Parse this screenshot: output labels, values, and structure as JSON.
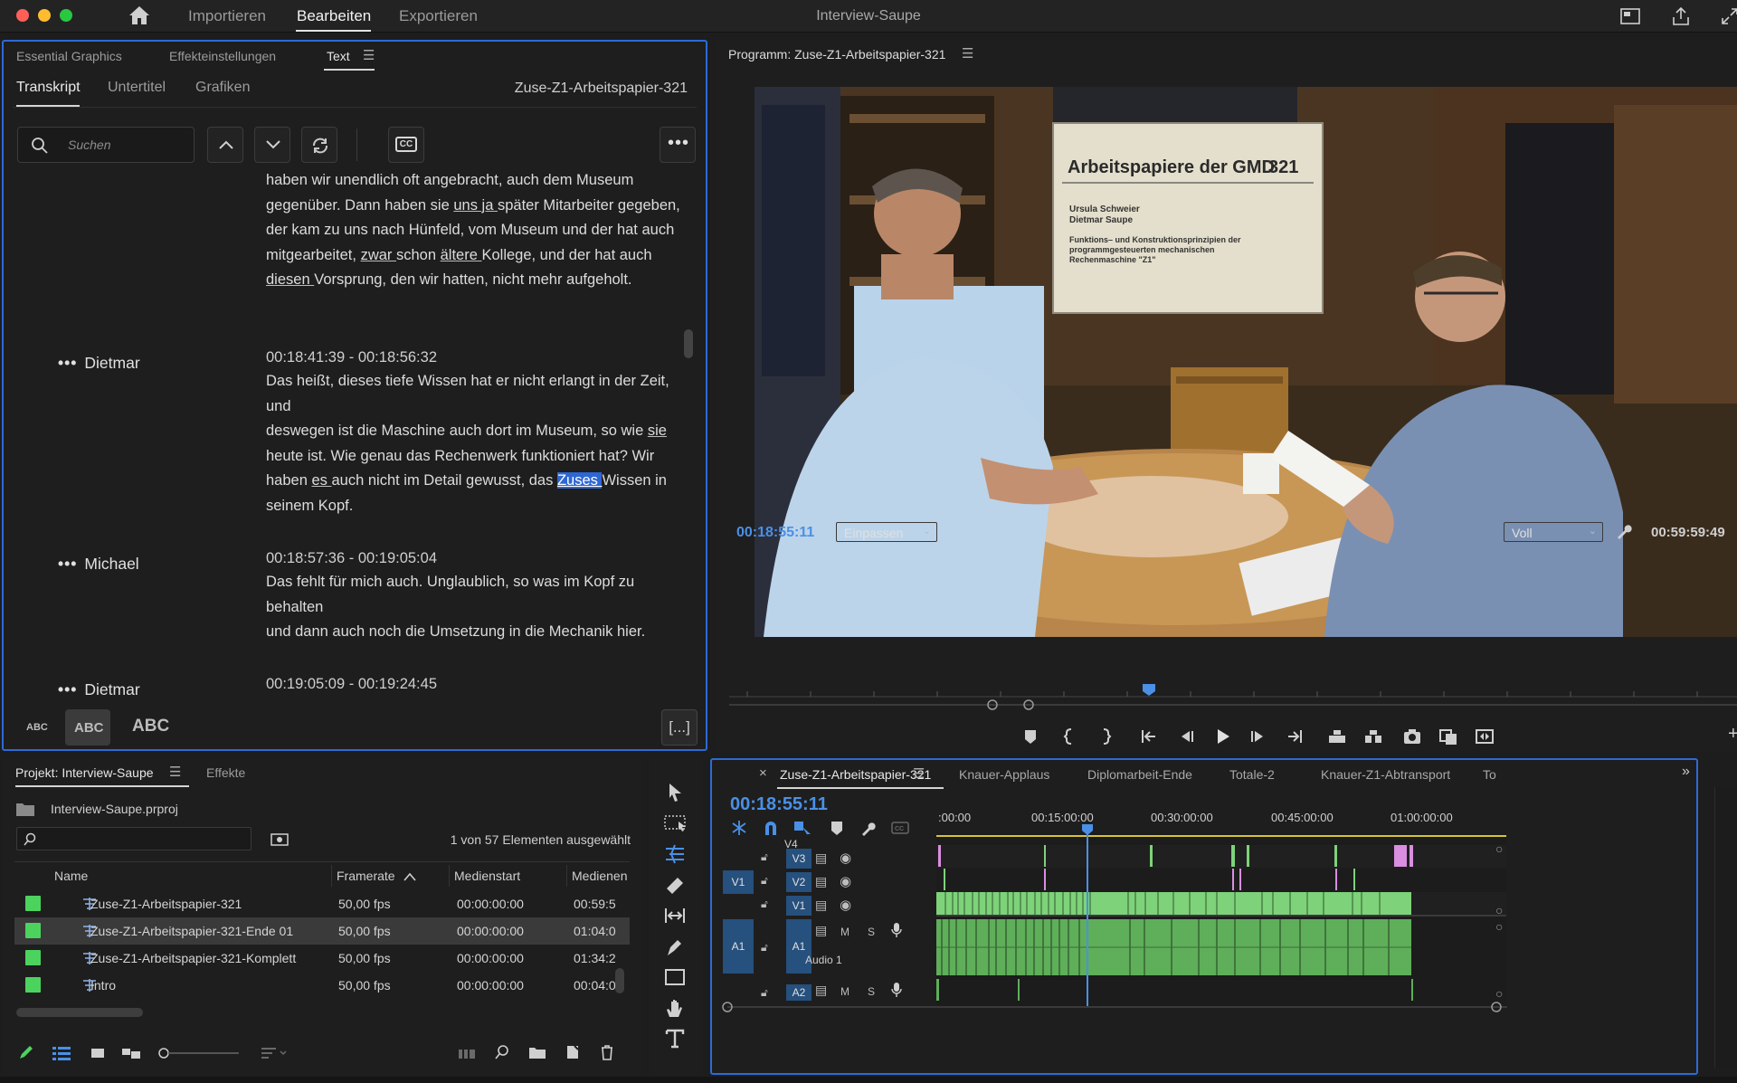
{
  "titlebar": {
    "tabs": [
      {
        "label": "Importieren",
        "active": false
      },
      {
        "label": "Bearbeiten",
        "active": true
      },
      {
        "label": "Exportieren",
        "active": false
      }
    ],
    "app_title": "Interview-Saupe"
  },
  "text_panel": {
    "panel_tabs": [
      "Essential Graphics",
      "Effekteinstellungen",
      "Text"
    ],
    "active_panel_tab": "Text",
    "sub_tabs": [
      "Transkript",
      "Untertitel",
      "Grafiken"
    ],
    "active_sub_tab": "Transkript",
    "sequence_name": "Zuse-Z1-Arbeitspapier-321",
    "search_placeholder": "Suchen",
    "cc_label": "CC",
    "transcript": {
      "p0_lines": [
        "haben wir unendlich oft angebracht, auch dem Museum",
        "gegenüber. Dann haben sie ",
        "uns ja ",
        "später Mitarbeiter gegeben,",
        "der kam zu uns nach Hünfeld, vom Museum und der hat auch",
        "mitgearbeitet, ",
        "zwar ",
        "schon ",
        "ältere ",
        "Kollege, und der hat auch",
        "diesen ",
        "Vorsprung, den wir hatten, nicht mehr aufgeholt."
      ],
      "b1_speaker": "Dietmar",
      "b1_time": "00:18:41:39 - 00:18:56:32",
      "b1_parts": [
        "Das heißt, dieses tiefe Wissen hat er nicht erlangt in der Zeit, und",
        "deswegen ist die Maschine auch dort im Museum, so wie ",
        "sie ",
        "heute ist. Wie genau das Rechenwerk funktioniert hat? Wir",
        "haben ",
        "es ",
        "auch nicht im Detail gewusst, das ",
        "Zuses ",
        "Wissen in",
        "seinem Kopf."
      ],
      "b2_speaker": "Michael",
      "b2_time": "00:18:57:36 - 00:19:05:04",
      "b2_lines": [
        "Das fehlt für mich auch. Unglaublich, so was im Kopf zu behalten",
        "und dann auch noch die Umsetzung in die Mechanik hier."
      ],
      "b3_speaker": "Dietmar",
      "b3_time": "00:19:05:09 - 00:19:24:45"
    },
    "case_buttons": [
      "ABC",
      "ABC",
      "ABC"
    ],
    "bracket_label": "[...]"
  },
  "program": {
    "title": "Programm: Zuse-Z1-Arbeitspapier-321",
    "timecode": "00:18:55:11",
    "fit_select": "Einpassen",
    "quality_select": "Voll",
    "duration": "00:59:59:49",
    "video_sign": {
      "heading": "Arbeitspapiere der GMD",
      "number": "321",
      "authors": [
        "Ursula Schweier",
        "Dietmar Saupe"
      ],
      "subtitle": [
        "Funktions– und Konstruktionsprinzipien der",
        "programmgesteuerten mechanischen",
        "Rechenmaschine \"Z1\""
      ]
    }
  },
  "project": {
    "tabs": [
      "Projekt: Interview-Saupe",
      "Effekte"
    ],
    "file": "Interview-Saupe.prproj",
    "selection_info": "1 von 57 Elementen ausgewählt",
    "columns": [
      "Name",
      "Framerate",
      "Medienstart",
      "Medienen"
    ],
    "rows": [
      {
        "name": "Zuse-Z1-Arbeitspapier-321",
        "fps": "50,00 fps",
        "start": "00:00:00:00",
        "end": "00:59:5",
        "selected": false
      },
      {
        "name": "Zuse-Z1-Arbeitspapier-321-Ende 01",
        "fps": "50,00 fps",
        "start": "00:00:00:00",
        "end": "01:04:0",
        "selected": true
      },
      {
        "name": "Zuse-Z1-Arbeitspapier-321-Komplett",
        "fps": "50,00 fps",
        "start": "00:00:00:00",
        "end": "01:34:2",
        "selected": false
      },
      {
        "name": "Intro",
        "fps": "50,00 fps",
        "start": "00:00:00:00",
        "end": "00:04:0",
        "selected": false
      }
    ],
    "colors": {
      "swatch": "#4cd35e"
    }
  },
  "timeline": {
    "tabs": [
      "Zuse-Z1-Arbeitspapier-321",
      "Knauer-Applaus",
      "Diplomarbeit-Ende",
      "Totale-2",
      "Knauer-Z1-Abtransport",
      "To"
    ],
    "active_tab": "Zuse-Z1-Arbeitspapier-321",
    "timecode": "00:18:55:11",
    "ruler": [
      ":00:00",
      "00:15:00:00",
      "00:30:00:00",
      "00:45:00:00",
      "01:00:00:00"
    ],
    "tracks": {
      "v4": "V4",
      "v3": "V3",
      "v2": "V2",
      "v1": "V1",
      "a1": "A1",
      "a2": "A2",
      "src_v1": "V1",
      "src_a1": "A1",
      "audio_name": "Audio 1",
      "mute": "M",
      "solo": "S"
    },
    "colors": {
      "video_clip": "#7ed27a",
      "marker_clip": "#d98ee0",
      "audio_clip": "#5fae5a",
      "playhead": "#4a90e6"
    }
  },
  "colors": {
    "accent": "#2d6ad6",
    "timecode": "#4a90e6"
  }
}
